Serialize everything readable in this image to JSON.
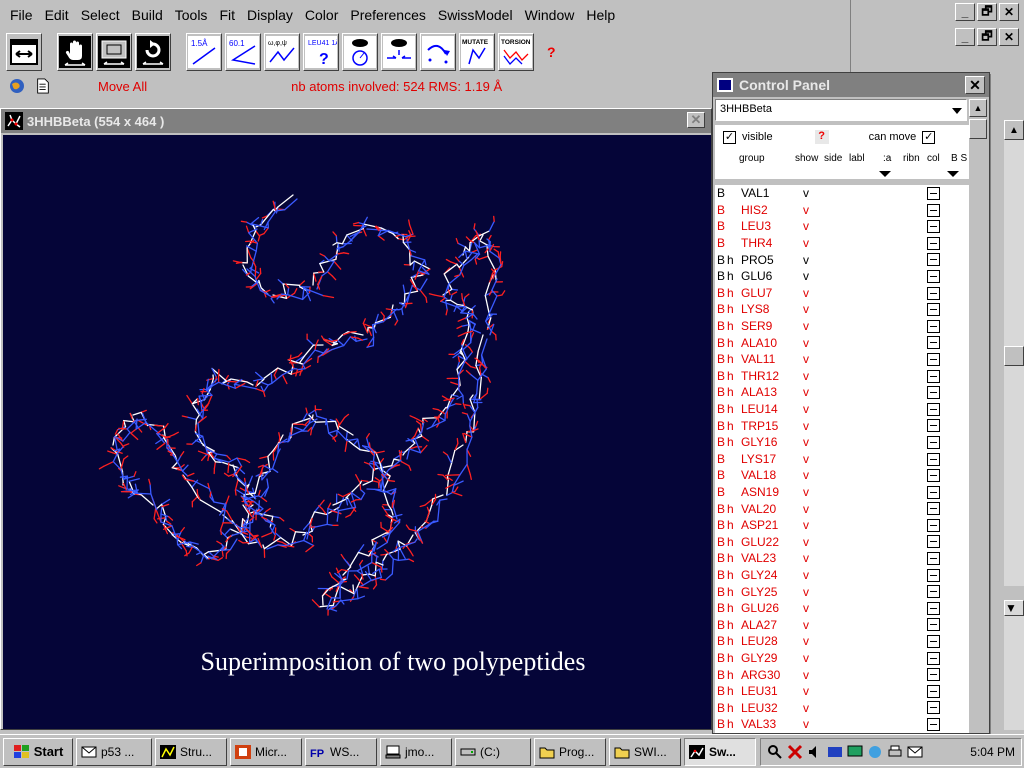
{
  "menubar": {
    "items": [
      "File",
      "Edit",
      "Select",
      "Build",
      "Tools",
      "Fit",
      "Display",
      "Color",
      "Preferences",
      "SwissModel",
      "Window",
      "Help"
    ]
  },
  "toolbar": {
    "tool_labels": [
      "1.5Å",
      "60.1",
      "ω,φ,ψ",
      "LEU41 1Å",
      "MUTATE",
      "TORSION"
    ],
    "help": "?"
  },
  "statusbar": {
    "mode": "Move All",
    "atoms_info": "nb atoms involved: 524    RMS: 1.19 Å"
  },
  "molecule_window": {
    "title": "3HHBBeta  (554 x 464 )",
    "close": "✕",
    "caption": "Superimposition of two polypeptides",
    "colors": {
      "background": "#050538",
      "bond_white": "#ffffff",
      "bond_blue": "#3a5aff",
      "bond_red": "#ff2020"
    }
  },
  "control_panel": {
    "title": "Control Panel",
    "close": "✕",
    "selected_layer": "3HHBBeta",
    "visible_label": "visible",
    "visible_checked": "✓",
    "can_move_label": "can move",
    "can_move_checked": "✓",
    "help": "?",
    "columns": {
      "group": "group",
      "show": "show",
      "side": "side",
      "labl": "labl",
      "a": ":a",
      "ribn": "ribn",
      "col": "col",
      "bs": "B S"
    },
    "residues": [
      {
        "chain": "B",
        "h": "",
        "name": "VAL1",
        "vis": "v",
        "red": false
      },
      {
        "chain": "B",
        "h": "",
        "name": "HIS2",
        "vis": "v",
        "red": true
      },
      {
        "chain": "B",
        "h": "",
        "name": "LEU3",
        "vis": "v",
        "red": true
      },
      {
        "chain": "B",
        "h": "",
        "name": "THR4",
        "vis": "v",
        "red": true
      },
      {
        "chain": "B",
        "h": "h",
        "name": "PRO5",
        "vis": "v",
        "red": false
      },
      {
        "chain": "B",
        "h": "h",
        "name": "GLU6",
        "vis": "v",
        "red": false
      },
      {
        "chain": "B",
        "h": "h",
        "name": "GLU7",
        "vis": "v",
        "red": true
      },
      {
        "chain": "B",
        "h": "h",
        "name": "LYS8",
        "vis": "v",
        "red": true
      },
      {
        "chain": "B",
        "h": "h",
        "name": "SER9",
        "vis": "v",
        "red": true
      },
      {
        "chain": "B",
        "h": "h",
        "name": "ALA10",
        "vis": "v",
        "red": true
      },
      {
        "chain": "B",
        "h": "h",
        "name": "VAL11",
        "vis": "v",
        "red": true
      },
      {
        "chain": "B",
        "h": "h",
        "name": "THR12",
        "vis": "v",
        "red": true
      },
      {
        "chain": "B",
        "h": "h",
        "name": "ALA13",
        "vis": "v",
        "red": true
      },
      {
        "chain": "B",
        "h": "h",
        "name": "LEU14",
        "vis": "v",
        "red": true
      },
      {
        "chain": "B",
        "h": "h",
        "name": "TRP15",
        "vis": "v",
        "red": true
      },
      {
        "chain": "B",
        "h": "h",
        "name": "GLY16",
        "vis": "v",
        "red": true
      },
      {
        "chain": "B",
        "h": "",
        "name": "LYS17",
        "vis": "v",
        "red": true
      },
      {
        "chain": "B",
        "h": "",
        "name": "VAL18",
        "vis": "v",
        "red": true
      },
      {
        "chain": "B",
        "h": "",
        "name": "ASN19",
        "vis": "v",
        "red": true
      },
      {
        "chain": "B",
        "h": "h",
        "name": "VAL20",
        "vis": "v",
        "red": true
      },
      {
        "chain": "B",
        "h": "h",
        "name": "ASP21",
        "vis": "v",
        "red": true
      },
      {
        "chain": "B",
        "h": "h",
        "name": "GLU22",
        "vis": "v",
        "red": true
      },
      {
        "chain": "B",
        "h": "h",
        "name": "VAL23",
        "vis": "v",
        "red": true
      },
      {
        "chain": "B",
        "h": "h",
        "name": "GLY24",
        "vis": "v",
        "red": true
      },
      {
        "chain": "B",
        "h": "h",
        "name": "GLY25",
        "vis": "v",
        "red": true
      },
      {
        "chain": "B",
        "h": "h",
        "name": "GLU26",
        "vis": "v",
        "red": true
      },
      {
        "chain": "B",
        "h": "h",
        "name": "ALA27",
        "vis": "v",
        "red": true
      },
      {
        "chain": "B",
        "h": "h",
        "name": "LEU28",
        "vis": "v",
        "red": true
      },
      {
        "chain": "B",
        "h": "h",
        "name": "GLY29",
        "vis": "v",
        "red": true
      },
      {
        "chain": "B",
        "h": "h",
        "name": "ARG30",
        "vis": "v",
        "red": true
      },
      {
        "chain": "B",
        "h": "h",
        "name": "LEU31",
        "vis": "v",
        "red": true
      },
      {
        "chain": "B",
        "h": "h",
        "name": "LEU32",
        "vis": "v",
        "red": true
      },
      {
        "chain": "B",
        "h": "h",
        "name": "VAL33",
        "vis": "v",
        "red": true
      }
    ]
  },
  "taskbar": {
    "start": "Start",
    "tasks": [
      "p53 ...",
      "Stru...",
      "Micr...",
      "WS...",
      "jmo...",
      "(C:)",
      "Prog...",
      "SWI...",
      "Sw..."
    ],
    "active_index": 8,
    "clock": "5:04 PM"
  },
  "bg_window": {
    "minimize": "_",
    "restore": "🗗",
    "close": "✕"
  }
}
